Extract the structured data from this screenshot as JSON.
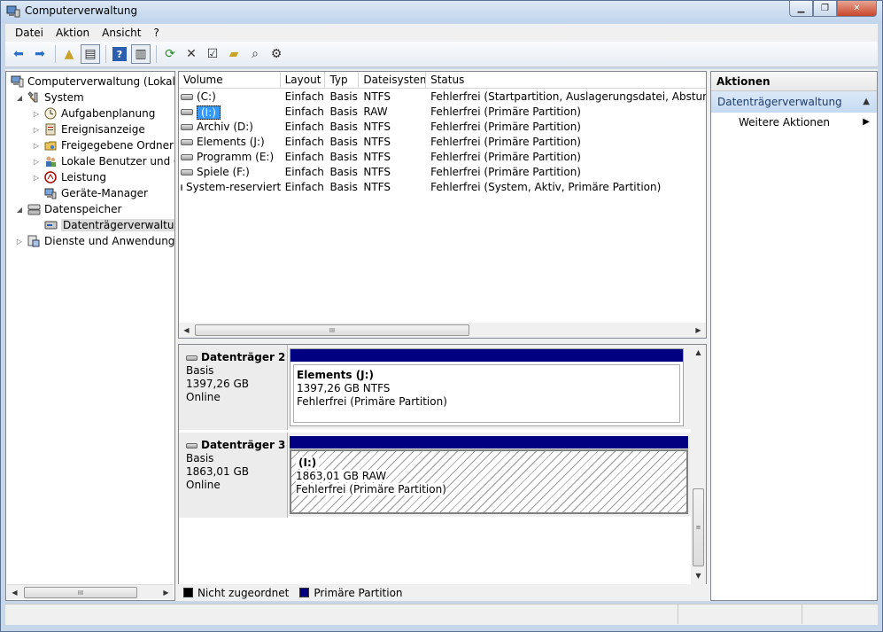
{
  "window": {
    "title": "Computerverwaltung",
    "min": "0",
    "max": "1",
    "close": "X"
  },
  "menu": [
    "Datei",
    "Aktion",
    "Ansicht",
    "?"
  ],
  "toolbar": {
    "back": "◀",
    "forward": "▶",
    "up": "↑",
    "show_hide": "▦",
    "help": "?",
    "panel": "▦",
    "refresh": "⟳",
    "delete": "✕",
    "properties": "☰",
    "open": "📂",
    "search": "🔍",
    "settings": "⚙"
  },
  "tree": {
    "items": [
      {
        "label": "Computerverwaltung (Lokal)",
        "icon": "computer-icon"
      },
      {
        "label": "System",
        "icon": "tools-icon"
      },
      {
        "label": "Aufgabenplanung",
        "icon": "clock-icon"
      },
      {
        "label": "Ereignisanzeige",
        "icon": "event-icon"
      },
      {
        "label": "Freigegebene Ordner",
        "icon": "shared-folder-icon"
      },
      {
        "label": "Lokale Benutzer und Gr",
        "icon": "users-icon"
      },
      {
        "label": "Leistung",
        "icon": "performance-icon"
      },
      {
        "label": "Geräte-Manager",
        "icon": "device-icon"
      },
      {
        "label": "Datenspeicher",
        "icon": "storage-icon"
      },
      {
        "label": "Datenträgerverwaltung",
        "icon": "disk-icon"
      },
      {
        "label": "Dienste und Anwendungen",
        "icon": "services-icon"
      }
    ],
    "scroll_thumb": "III"
  },
  "volumes": {
    "columns": [
      "Volume",
      "Layout",
      "Typ",
      "Dateisystem",
      "Status"
    ],
    "rows": [
      [
        "(C:)",
        "Einfach",
        "Basis",
        "NTFS",
        "Fehlerfrei (Startpartition, Auslagerungsdatei, Absturzabbild"
      ],
      [
        "(I:)",
        "Einfach",
        "Basis",
        "RAW",
        "Fehlerfrei (Primäre Partition)"
      ],
      [
        "Archiv (D:)",
        "Einfach",
        "Basis",
        "NTFS",
        "Fehlerfrei (Primäre Partition)"
      ],
      [
        "Elements (J:)",
        "Einfach",
        "Basis",
        "NTFS",
        "Fehlerfrei (Primäre Partition)"
      ],
      [
        "Programm (E:)",
        "Einfach",
        "Basis",
        "NTFS",
        "Fehlerfrei (Primäre Partition)"
      ],
      [
        "Spiele (F:)",
        "Einfach",
        "Basis",
        "NTFS",
        "Fehlerfrei (Primäre Partition)"
      ],
      [
        "System-reserviert",
        "Einfach",
        "Basis",
        "NTFS",
        "Fehlerfrei (System, Aktiv, Primäre Partition)"
      ]
    ],
    "scroll_thumb": "III"
  },
  "disks": [
    {
      "name": "Datenträger 2",
      "type": "Basis",
      "size": "1397,26 GB",
      "state": "Online",
      "partition": {
        "name": "Elements  (J:)",
        "size": "1397,26 GB NTFS",
        "status": "Fehlerfrei (Primäre Partition)"
      }
    },
    {
      "name": "Datenträger 3",
      "type": "Basis",
      "size": "1863,01 GB",
      "state": "Online",
      "partition": {
        "name": "(I:)",
        "size": "1863,01 GB RAW",
        "status": "Fehlerfrei (Primäre Partition)"
      }
    }
  ],
  "legend": [
    {
      "label": "Nicht zugeordnet",
      "color": "#000000"
    },
    {
      "label": "Primäre Partition",
      "color": "#000080"
    }
  ],
  "actions": {
    "title": "Aktionen",
    "section": "Datenträgerverwaltung",
    "item": "Weitere Aktionen"
  },
  "colors": {
    "selection": "#3399ff",
    "partition_bar": "#000080"
  }
}
